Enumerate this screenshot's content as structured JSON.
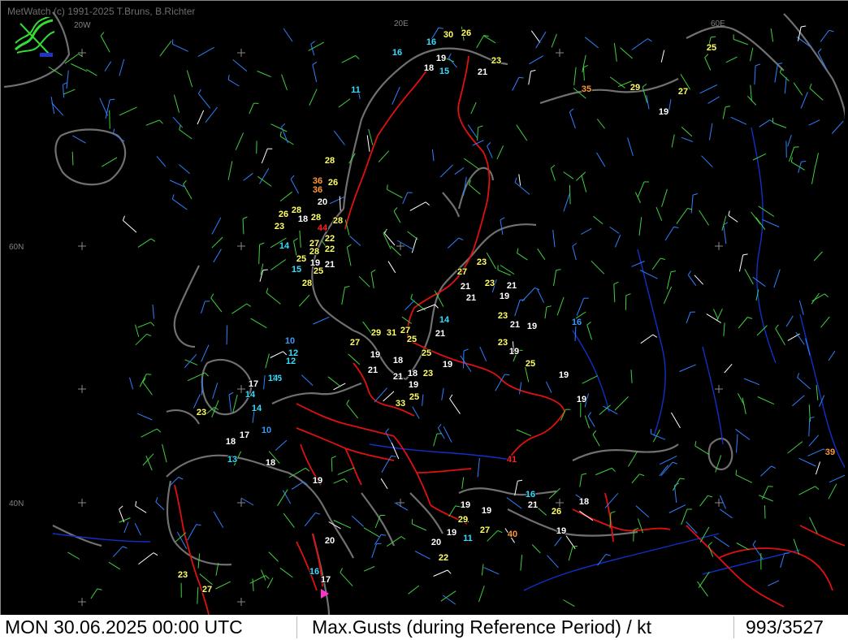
{
  "credit": "MetWatch  (c) 1991-2025 T.Bruns, B.Richter",
  "graticule": {
    "lon_labels": [
      {
        "text": "20W",
        "key": "w20"
      },
      {
        "text": "20E",
        "key": "e20"
      },
      {
        "text": "60E",
        "key": "e60"
      }
    ],
    "lat_labels": [
      {
        "text": "60N",
        "key": "n60"
      },
      {
        "text": "40N",
        "key": "n40"
      }
    ]
  },
  "status_bar": {
    "datetime": "MON 30.06.2025 00:00 UTC",
    "parameter": "Max.Gusts (during Reference Period) / kt",
    "count": "993/3527"
  },
  "colors": {
    "white": "#ffffff",
    "yellow": "#ffff66",
    "cyan": "#33ddff",
    "blue": "#3399ff",
    "orange": "#ff9933",
    "red": "#ff2020",
    "border": "#e01010",
    "coast": "#707070",
    "river": "#1030c8",
    "wind_green": "#40d040",
    "wind_blue": "#3080ff",
    "wind_white": "#ffffff"
  },
  "gust_values": [
    {
      "v": "30",
      "c": "yellow"
    },
    {
      "v": "26",
      "c": "yellow"
    },
    {
      "v": "16",
      "c": "cyan"
    },
    {
      "v": "16",
      "c": "cyan"
    },
    {
      "v": "19",
      "c": "white"
    },
    {
      "v": "18",
      "c": "white"
    },
    {
      "v": "15",
      "c": "cyan"
    },
    {
      "v": "23",
      "c": "yellow"
    },
    {
      "v": "21",
      "c": "white"
    },
    {
      "v": "11",
      "c": "cyan"
    },
    {
      "v": "35",
      "c": "orange"
    },
    {
      "v": "29",
      "c": "yellow"
    },
    {
      "v": "27",
      "c": "yellow"
    },
    {
      "v": "19",
      "c": "white"
    },
    {
      "v": "25",
      "c": "yellow"
    },
    {
      "v": "28",
      "c": "yellow"
    },
    {
      "v": "36",
      "c": "orange"
    },
    {
      "v": "26",
      "c": "yellow"
    },
    {
      "v": "36",
      "c": "orange"
    },
    {
      "v": "20",
      "c": "white"
    },
    {
      "v": "26",
      "c": "yellow"
    },
    {
      "v": "28",
      "c": "yellow"
    },
    {
      "v": "18",
      "c": "white"
    },
    {
      "v": "28",
      "c": "yellow"
    },
    {
      "v": "23",
      "c": "yellow"
    },
    {
      "v": "28",
      "c": "yellow"
    },
    {
      "v": "44",
      "c": "red"
    },
    {
      "v": "27",
      "c": "yellow"
    },
    {
      "v": "22",
      "c": "yellow"
    },
    {
      "v": "14",
      "c": "cyan"
    },
    {
      "v": "28",
      "c": "yellow"
    },
    {
      "v": "22",
      "c": "yellow"
    },
    {
      "v": "25",
      "c": "yellow"
    },
    {
      "v": "19",
      "c": "white"
    },
    {
      "v": "21",
      "c": "white"
    },
    {
      "v": "15",
      "c": "cyan"
    },
    {
      "v": "25",
      "c": "yellow"
    },
    {
      "v": "27",
      "c": "yellow"
    },
    {
      "v": "23",
      "c": "yellow"
    },
    {
      "v": "28",
      "c": "yellow"
    },
    {
      "v": "21",
      "c": "white"
    },
    {
      "v": "23",
      "c": "yellow"
    },
    {
      "v": "21",
      "c": "white"
    },
    {
      "v": "19",
      "c": "white"
    },
    {
      "v": "21",
      "c": "white"
    },
    {
      "v": "23",
      "c": "yellow"
    },
    {
      "v": "14",
      "c": "cyan"
    },
    {
      "v": "21",
      "c": "white"
    },
    {
      "v": "19",
      "c": "white"
    },
    {
      "v": "16",
      "c": "blue"
    },
    {
      "v": "27",
      "c": "yellow"
    },
    {
      "v": "29",
      "c": "yellow"
    },
    {
      "v": "31",
      "c": "yellow"
    },
    {
      "v": "27",
      "c": "yellow"
    },
    {
      "v": "25",
      "c": "yellow"
    },
    {
      "v": "21",
      "c": "white"
    },
    {
      "v": "23",
      "c": "yellow"
    },
    {
      "v": "10",
      "c": "blue"
    },
    {
      "v": "19",
      "c": "white"
    },
    {
      "v": "25",
      "c": "yellow"
    },
    {
      "v": "19",
      "c": "white"
    },
    {
      "v": "12",
      "c": "cyan"
    },
    {
      "v": "12",
      "c": "cyan"
    },
    {
      "v": "18",
      "c": "white"
    },
    {
      "v": "19",
      "c": "white"
    },
    {
      "v": "21",
      "c": "white"
    },
    {
      "v": "18",
      "c": "white"
    },
    {
      "v": "23",
      "c": "yellow"
    },
    {
      "v": "25",
      "c": "yellow"
    },
    {
      "v": "19",
      "c": "white"
    },
    {
      "v": "17",
      "c": "white"
    },
    {
      "v": "14",
      "c": "cyan"
    },
    {
      "v": "16",
      "c": "cyan"
    },
    {
      "v": "21",
      "c": "white"
    },
    {
      "v": "14",
      "c": "cyan"
    },
    {
      "v": "25",
      "c": "yellow"
    },
    {
      "v": "19",
      "c": "white"
    },
    {
      "v": "14",
      "c": "cyan"
    },
    {
      "v": "33",
      "c": "yellow"
    },
    {
      "v": "23",
      "c": "yellow"
    },
    {
      "v": "19",
      "c": "white"
    },
    {
      "v": "17",
      "c": "white"
    },
    {
      "v": "10",
      "c": "blue"
    },
    {
      "v": "18",
      "c": "white"
    },
    {
      "v": "13",
      "c": "cyan"
    },
    {
      "v": "18",
      "c": "white"
    },
    {
      "v": "41",
      "c": "red"
    },
    {
      "v": "39",
      "c": "orange"
    },
    {
      "v": "19",
      "c": "white"
    },
    {
      "v": "19",
      "c": "white"
    },
    {
      "v": "16",
      "c": "cyan"
    },
    {
      "v": "21",
      "c": "white"
    },
    {
      "v": "19",
      "c": "white"
    },
    {
      "v": "21",
      "c": "white"
    },
    {
      "v": "27",
      "c": "yellow"
    },
    {
      "v": "18",
      "c": "white"
    },
    {
      "v": "26",
      "c": "yellow"
    },
    {
      "v": "29",
      "c": "yellow"
    },
    {
      "v": "19",
      "c": "white"
    },
    {
      "v": "19",
      "c": "white"
    },
    {
      "v": "11",
      "c": "cyan"
    },
    {
      "v": "40",
      "c": "orange"
    },
    {
      "v": "20",
      "c": "white"
    },
    {
      "v": "20",
      "c": "white"
    },
    {
      "v": "22",
      "c": "yellow"
    },
    {
      "v": "16",
      "c": "cyan"
    },
    {
      "v": "17",
      "c": "white"
    },
    {
      "v": "23",
      "c": "yellow"
    },
    {
      "v": "27",
      "c": "yellow"
    }
  ]
}
